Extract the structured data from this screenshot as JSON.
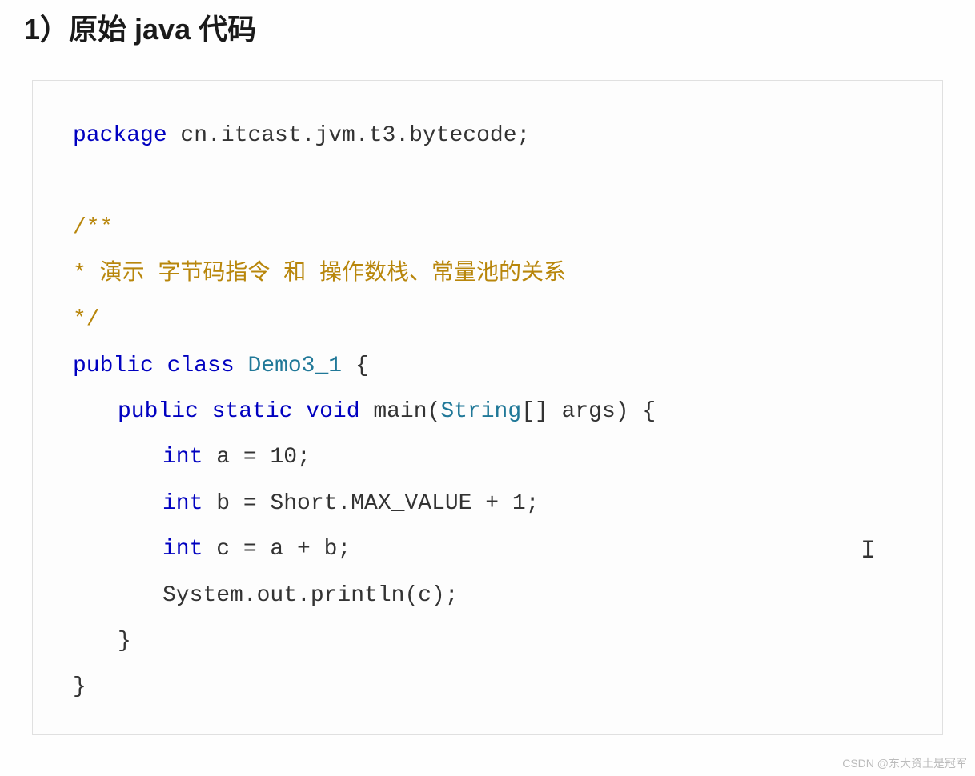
{
  "heading": "1）原始 java 代码",
  "code": {
    "package_kw": "package",
    "package_name": " cn.itcast.jvm.t3.bytecode;",
    "comment_open": "/**",
    "comment_body": " * 演示 字节码指令 和 操作数栈、常量池的关系",
    "comment_close": " */",
    "public_kw": "public",
    "class_kw": "class",
    "class_name": "Demo3_1",
    "brace_open": " {",
    "static_kw": "static",
    "void_kw": "void",
    "main_name": "main",
    "main_params_open": "(",
    "string_type": "String",
    "main_params_rest": "[] args) {",
    "int_kw": "int",
    "var_a": " a = ",
    "val_10": "10",
    "semi": ";",
    "var_b": " b = Short.MAX_VALUE + ",
    "val_1": "1",
    "var_c": " c = a + b;",
    "println": "System.out.println(c);",
    "brace_close1": "}",
    "brace_close2": "}"
  },
  "watermark": "CSDN @东大资土是冠军"
}
